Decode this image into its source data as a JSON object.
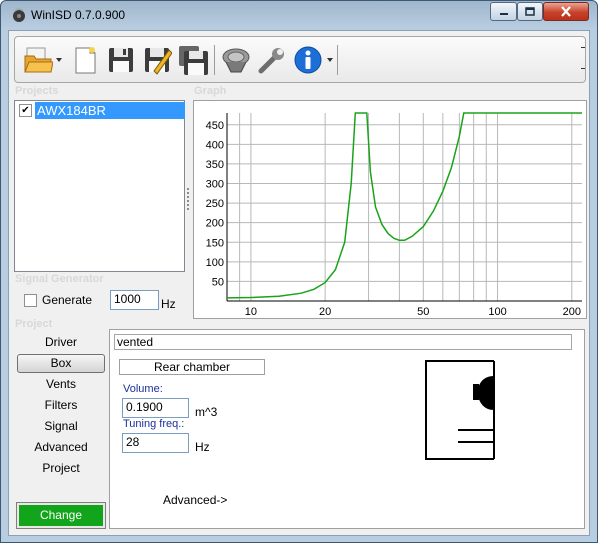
{
  "window": {
    "title": "WinISD 0.7.0.900",
    "controls": [
      "minimize-icon",
      "maximize-icon",
      "close-icon"
    ]
  },
  "toolbar": {
    "tools": [
      {
        "name": "open-folder-icon",
        "dropdown": true
      },
      {
        "name": "new-file-icon",
        "dropdown": false
      },
      {
        "name": "save-icon",
        "dropdown": false
      },
      {
        "name": "save-as-icon",
        "dropdown": false
      },
      {
        "name": "save-all-icon",
        "dropdown": false
      },
      {
        "name": "speaker-driver-icon",
        "dropdown": false
      },
      {
        "name": "wrench-icon",
        "dropdown": false
      },
      {
        "name": "info-icon",
        "dropdown": true
      }
    ]
  },
  "projects": {
    "label": "Projects",
    "items": [
      {
        "name": "AWX184BR",
        "checked": true,
        "selected": true
      }
    ]
  },
  "graph": {
    "label": "Graph",
    "color_curve": "#1aa31a",
    "color_grid": "#b8b8b8"
  },
  "chart_data": {
    "type": "line",
    "title": "",
    "xlabel": "",
    "ylabel": "",
    "x_scale": "log",
    "xlim": [
      8,
      220
    ],
    "ylim": [
      0,
      480
    ],
    "x_ticks": [
      10,
      20,
      50,
      100,
      200
    ],
    "y_ticks": [
      50,
      100,
      150,
      200,
      250,
      300,
      350,
      400,
      450
    ],
    "grid": true,
    "series": [
      {
        "color": "#1aa31a",
        "points": [
          [
            8,
            8
          ],
          [
            10,
            9
          ],
          [
            13,
            12
          ],
          [
            16,
            20
          ],
          [
            18,
            30
          ],
          [
            20,
            47
          ],
          [
            22,
            80
          ],
          [
            24,
            150
          ],
          [
            25.5,
            300
          ],
          [
            26.5,
            480
          ],
          [
            29.5,
            480
          ],
          [
            30.5,
            330
          ],
          [
            32,
            240
          ],
          [
            34,
            195
          ],
          [
            36,
            172
          ],
          [
            38,
            160
          ],
          [
            40,
            155
          ],
          [
            42,
            155
          ],
          [
            45,
            165
          ],
          [
            50,
            190
          ],
          [
            55,
            230
          ],
          [
            60,
            280
          ],
          [
            65,
            340
          ],
          [
            70,
            420
          ],
          [
            73,
            480
          ],
          [
            220,
            480
          ]
        ]
      }
    ]
  },
  "signal_generator": {
    "label": "Signal Generator",
    "generate_label": "Generate",
    "generate_checked": false,
    "frequency": "1000",
    "unit": "Hz"
  },
  "project_panel": {
    "label": "Project",
    "nav": [
      "Driver",
      "Box",
      "Vents",
      "Filters",
      "Signal",
      "Advanced",
      "Project"
    ],
    "selected_index": 1,
    "change_button": "Change"
  },
  "box": {
    "type": "vented",
    "rear_chamber_button": "Rear chamber",
    "volume_label": "Volume:",
    "volume_value": "0.1900",
    "volume_unit": "m^3",
    "tuning_label": "Tuning freq.:",
    "tuning_value": "28",
    "tuning_unit": "Hz",
    "advanced_link": "Advanced->"
  }
}
